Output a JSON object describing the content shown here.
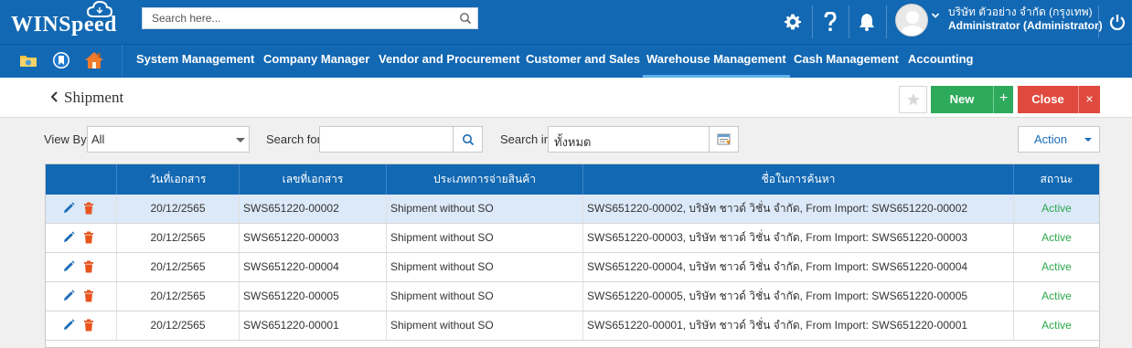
{
  "app": {
    "logo_text": "WINSpeed",
    "search_placeholder": "Search here..."
  },
  "user": {
    "company": "บริษัท ตัวอย่าง จำกัด (กรุงเทพ)",
    "role": "Administrator (Administrator)"
  },
  "nav": {
    "items": [
      {
        "label": "System Management"
      },
      {
        "label": "Company Manager"
      },
      {
        "label": "Vendor and Procurement"
      },
      {
        "label": "Customer and Sales"
      },
      {
        "label": "Warehouse Management"
      },
      {
        "label": "Cash Management"
      },
      {
        "label": "Accounting"
      }
    ],
    "active": "Warehouse Management"
  },
  "page": {
    "title": "Shipment",
    "new_label": "New",
    "new_plus": "+",
    "close_label": "Close",
    "close_x": "×"
  },
  "filters": {
    "view_by_label": "View By",
    "view_by_value": "All",
    "search_for_label": "Search for",
    "search_for_value": "",
    "search_in_label": "Search in",
    "search_in_value": "ทั้งหมด",
    "action_label": "Action"
  },
  "table": {
    "columns": [
      "",
      "วันที่เอกสาร",
      "เลขที่เอกสาร",
      "ประเภทการจ่ายสินค้า",
      "ชื่อในการค้นหา",
      "สถานะ"
    ],
    "rows": [
      {
        "date": "20/12/2565",
        "doc_no": "SWS651220-00002",
        "type": "Shipment without SO",
        "search_name": "SWS651220-00002, บริษัท ชาวด์ วิชั่น จำกัด, From Import: SWS651220-00002",
        "status": "Active"
      },
      {
        "date": "20/12/2565",
        "doc_no": "SWS651220-00003",
        "type": "Shipment without SO",
        "search_name": "SWS651220-00003, บริษัท ชาวด์ วิชั่น จำกัด, From Import: SWS651220-00003",
        "status": "Active"
      },
      {
        "date": "20/12/2565",
        "doc_no": "SWS651220-00004",
        "type": "Shipment without SO",
        "search_name": "SWS651220-00004, บริษัท ชาวด์ วิชั่น จำกัด, From Import: SWS651220-00004",
        "status": "Active"
      },
      {
        "date": "20/12/2565",
        "doc_no": "SWS651220-00005",
        "type": "Shipment without SO",
        "search_name": "SWS651220-00005, บริษัท ชาวด์ วิชั่น จำกัด, From Import: SWS651220-00005",
        "status": "Active"
      },
      {
        "date": "20/12/2565",
        "doc_no": "SWS651220-00001",
        "type": "Shipment without SO",
        "search_name": "SWS651220-00001, บริษัท ชาวด์ วิชั่น จำกัด, From Import: SWS651220-00001",
        "status": "Active"
      }
    ],
    "selected_row": 0
  },
  "colors": {
    "brand_blue": "#1268b3",
    "new_green": "#2eaa5b",
    "close_red": "#e04a3e",
    "status_green": "#2ba84a",
    "edit_blue": "#1a6bb5",
    "delete_orange": "#e8541d"
  }
}
